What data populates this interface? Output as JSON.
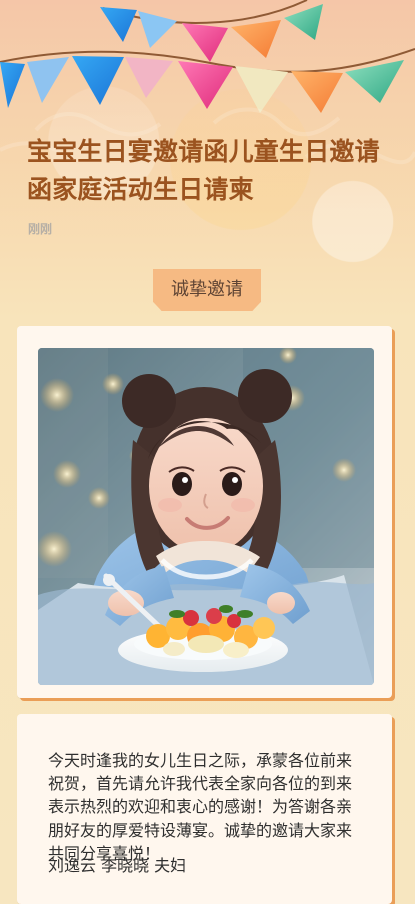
{
  "header": {
    "title": "宝宝生日宴邀请函儿童生日邀请函家庭活动生日请柬",
    "timestamp": "刚刚"
  },
  "invitation": {
    "badge_label": "诚挚邀请"
  },
  "message": {
    "body": "今天时逢我的女儿生日之际，承蒙各位前来祝贺，首先请允许我代表全家向各位的到来表示热烈的欢迎和衷心的感谢！为答谢各亲朋好友的厚爱特设薄宴。诚挚的邀请大家来共同分享喜悦！",
    "signature": "刘逸云  李晓晓 夫妇"
  },
  "colors": {
    "title": "#9b531f",
    "badge": "#f6ba83",
    "card_shadow": "#ea9e57",
    "background": "#f7e6c0"
  }
}
